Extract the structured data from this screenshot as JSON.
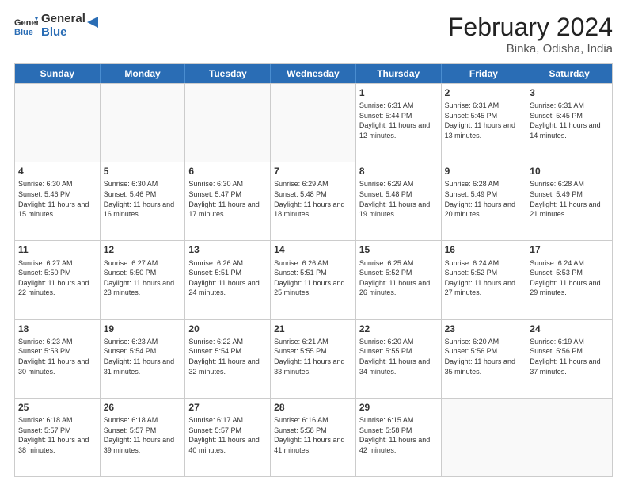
{
  "logo": {
    "general": "General",
    "blue": "Blue"
  },
  "title": "February 2024",
  "subtitle": "Binka, Odisha, India",
  "days": [
    "Sunday",
    "Monday",
    "Tuesday",
    "Wednesday",
    "Thursday",
    "Friday",
    "Saturday"
  ],
  "weeks": [
    [
      {
        "day": "",
        "text": ""
      },
      {
        "day": "",
        "text": ""
      },
      {
        "day": "",
        "text": ""
      },
      {
        "day": "",
        "text": ""
      },
      {
        "day": "1",
        "text": "Sunrise: 6:31 AM\nSunset: 5:44 PM\nDaylight: 11 hours and 12 minutes."
      },
      {
        "day": "2",
        "text": "Sunrise: 6:31 AM\nSunset: 5:45 PM\nDaylight: 11 hours and 13 minutes."
      },
      {
        "day": "3",
        "text": "Sunrise: 6:31 AM\nSunset: 5:45 PM\nDaylight: 11 hours and 14 minutes."
      }
    ],
    [
      {
        "day": "4",
        "text": "Sunrise: 6:30 AM\nSunset: 5:46 PM\nDaylight: 11 hours and 15 minutes."
      },
      {
        "day": "5",
        "text": "Sunrise: 6:30 AM\nSunset: 5:46 PM\nDaylight: 11 hours and 16 minutes."
      },
      {
        "day": "6",
        "text": "Sunrise: 6:30 AM\nSunset: 5:47 PM\nDaylight: 11 hours and 17 minutes."
      },
      {
        "day": "7",
        "text": "Sunrise: 6:29 AM\nSunset: 5:48 PM\nDaylight: 11 hours and 18 minutes."
      },
      {
        "day": "8",
        "text": "Sunrise: 6:29 AM\nSunset: 5:48 PM\nDaylight: 11 hours and 19 minutes."
      },
      {
        "day": "9",
        "text": "Sunrise: 6:28 AM\nSunset: 5:49 PM\nDaylight: 11 hours and 20 minutes."
      },
      {
        "day": "10",
        "text": "Sunrise: 6:28 AM\nSunset: 5:49 PM\nDaylight: 11 hours and 21 minutes."
      }
    ],
    [
      {
        "day": "11",
        "text": "Sunrise: 6:27 AM\nSunset: 5:50 PM\nDaylight: 11 hours and 22 minutes."
      },
      {
        "day": "12",
        "text": "Sunrise: 6:27 AM\nSunset: 5:50 PM\nDaylight: 11 hours and 23 minutes."
      },
      {
        "day": "13",
        "text": "Sunrise: 6:26 AM\nSunset: 5:51 PM\nDaylight: 11 hours and 24 minutes."
      },
      {
        "day": "14",
        "text": "Sunrise: 6:26 AM\nSunset: 5:51 PM\nDaylight: 11 hours and 25 minutes."
      },
      {
        "day": "15",
        "text": "Sunrise: 6:25 AM\nSunset: 5:52 PM\nDaylight: 11 hours and 26 minutes."
      },
      {
        "day": "16",
        "text": "Sunrise: 6:24 AM\nSunset: 5:52 PM\nDaylight: 11 hours and 27 minutes."
      },
      {
        "day": "17",
        "text": "Sunrise: 6:24 AM\nSunset: 5:53 PM\nDaylight: 11 hours and 29 minutes."
      }
    ],
    [
      {
        "day": "18",
        "text": "Sunrise: 6:23 AM\nSunset: 5:53 PM\nDaylight: 11 hours and 30 minutes."
      },
      {
        "day": "19",
        "text": "Sunrise: 6:23 AM\nSunset: 5:54 PM\nDaylight: 11 hours and 31 minutes."
      },
      {
        "day": "20",
        "text": "Sunrise: 6:22 AM\nSunset: 5:54 PM\nDaylight: 11 hours and 32 minutes."
      },
      {
        "day": "21",
        "text": "Sunrise: 6:21 AM\nSunset: 5:55 PM\nDaylight: 11 hours and 33 minutes."
      },
      {
        "day": "22",
        "text": "Sunrise: 6:20 AM\nSunset: 5:55 PM\nDaylight: 11 hours and 34 minutes."
      },
      {
        "day": "23",
        "text": "Sunrise: 6:20 AM\nSunset: 5:56 PM\nDaylight: 11 hours and 35 minutes."
      },
      {
        "day": "24",
        "text": "Sunrise: 6:19 AM\nSunset: 5:56 PM\nDaylight: 11 hours and 37 minutes."
      }
    ],
    [
      {
        "day": "25",
        "text": "Sunrise: 6:18 AM\nSunset: 5:57 PM\nDaylight: 11 hours and 38 minutes."
      },
      {
        "day": "26",
        "text": "Sunrise: 6:18 AM\nSunset: 5:57 PM\nDaylight: 11 hours and 39 minutes."
      },
      {
        "day": "27",
        "text": "Sunrise: 6:17 AM\nSunset: 5:57 PM\nDaylight: 11 hours and 40 minutes."
      },
      {
        "day": "28",
        "text": "Sunrise: 6:16 AM\nSunset: 5:58 PM\nDaylight: 11 hours and 41 minutes."
      },
      {
        "day": "29",
        "text": "Sunrise: 6:15 AM\nSunset: 5:58 PM\nDaylight: 11 hours and 42 minutes."
      },
      {
        "day": "",
        "text": ""
      },
      {
        "day": "",
        "text": ""
      }
    ]
  ]
}
